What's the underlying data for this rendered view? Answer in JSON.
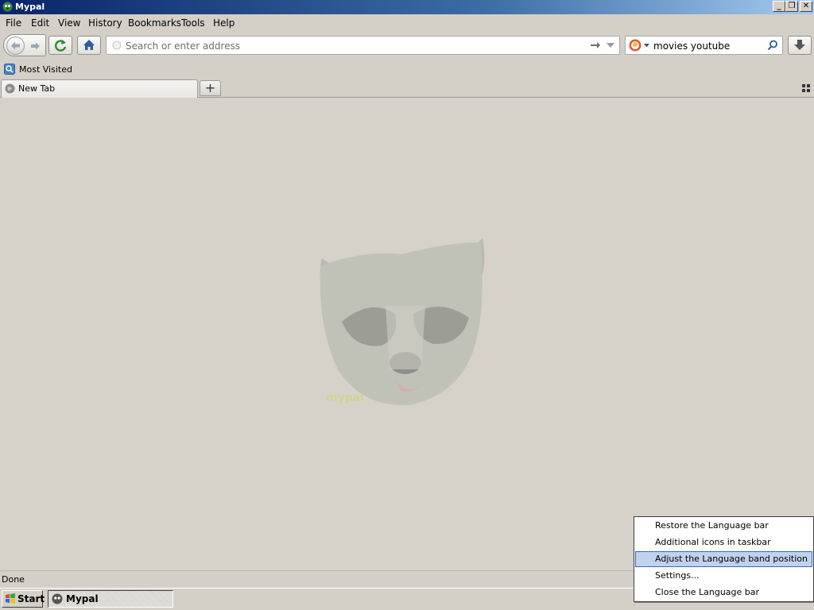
{
  "window": {
    "title": "Mypal",
    "minimize_glyph": "_",
    "restore_glyph": "❐",
    "close_glyph": "✕"
  },
  "menubar": {
    "items": [
      {
        "label": "File"
      },
      {
        "label": "Edit"
      },
      {
        "label": "View"
      },
      {
        "label": "History"
      },
      {
        "label": "Bookmarks"
      },
      {
        "label": "Tools"
      },
      {
        "label": "Help"
      }
    ]
  },
  "navbar": {
    "url_value": "",
    "url_placeholder": "Search or enter address",
    "search_value": "movies youtube",
    "search_engine_icon": "duckduckgo-icon"
  },
  "bookmarks": {
    "items": [
      {
        "label": "Most Visited"
      }
    ]
  },
  "tabs": {
    "items": [
      {
        "label": "New Tab",
        "active": true
      }
    ],
    "new_tab_glyph": "+"
  },
  "status": {
    "text": "Done"
  },
  "taskbar": {
    "start_label": "Start",
    "tasks": [
      {
        "label": "Mypal"
      }
    ]
  },
  "context_menu": {
    "items": [
      {
        "label": "Restore the Language bar",
        "accel": "R",
        "highlighted": false
      },
      {
        "label": "Additional icons in taskbar",
        "accel": "A",
        "highlighted": false
      },
      {
        "label": "Adjust the Language band position",
        "accel": "A",
        "highlighted": true
      },
      {
        "label": "Settings...",
        "accel": "S",
        "highlighted": false
      },
      {
        "label": "Close the Language bar",
        "accel": "C",
        "highlighted": false
      }
    ]
  },
  "colors": {
    "titlebar_start": "#0a246a",
    "titlebar_end": "#a6caf0",
    "highlight": "#c1d2ee",
    "highlight_border": "#316ac5"
  }
}
